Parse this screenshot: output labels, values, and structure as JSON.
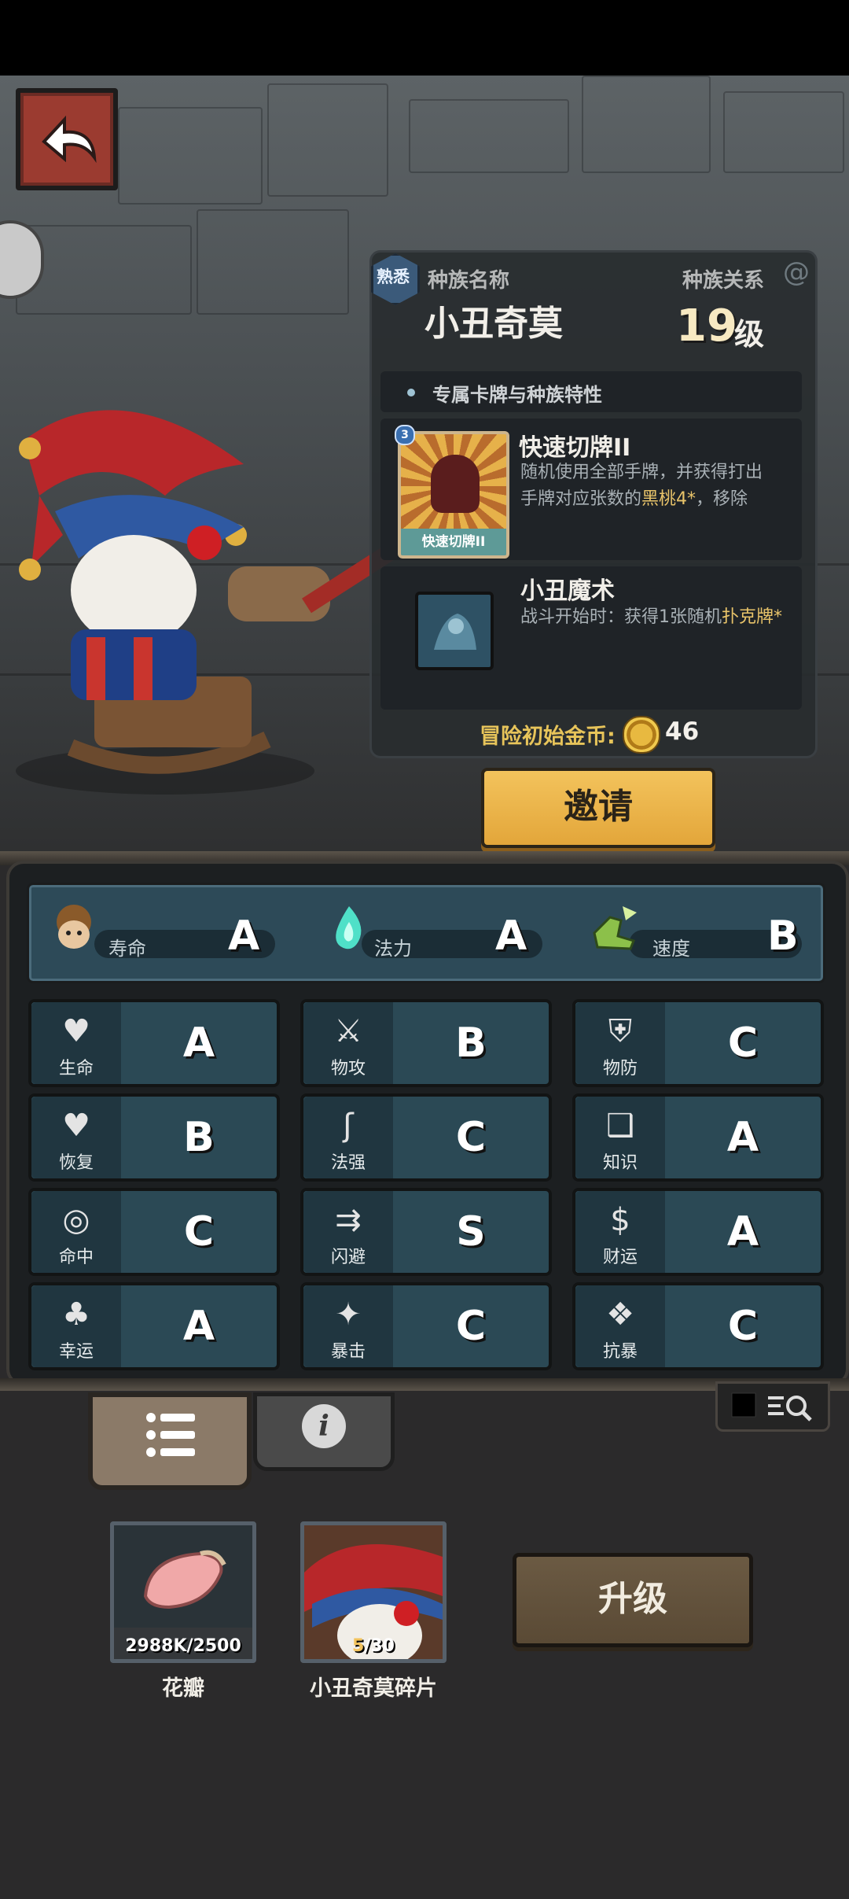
{
  "header": {
    "familiar_badge": "熟悉",
    "race_name_label": "种族名称",
    "race_relation_label": "种族关系",
    "race_name": "小丑奇莫",
    "level": "19",
    "level_unit": "级"
  },
  "section_title": "专属卡牌与种族特性",
  "cards": [
    {
      "title": "快速切牌II",
      "card_label": "快速切牌II",
      "cost": "3",
      "desc_line1": "随机使用全部手牌，并获得打出",
      "desc_line2_pre": "手牌对应张数的",
      "desc_line2_hl": "黑桃4*",
      "desc_line2_post": "，移除"
    },
    {
      "title": "小丑魔术",
      "desc_pre": "战斗开始时：获得1张随机",
      "desc_hl": "扑克牌*"
    }
  ],
  "coin": {
    "label": "冒险初始金币:",
    "value": "46"
  },
  "invite_label": "邀请",
  "attributes": [
    {
      "label": "寿命",
      "grade": "A",
      "icon": "lifespan-icon"
    },
    {
      "label": "法力",
      "grade": "A",
      "icon": "mana-flame-icon"
    },
    {
      "label": "速度",
      "grade": "B",
      "icon": "speed-boot-icon"
    }
  ],
  "stats": [
    {
      "label": "生命",
      "grade": "A",
      "icon": "heart-icon",
      "glyph": "♥"
    },
    {
      "label": "物攻",
      "grade": "B",
      "icon": "sword-icon",
      "glyph": "⚔"
    },
    {
      "label": "物防",
      "grade": "C",
      "icon": "armor-icon",
      "glyph": "⛨"
    },
    {
      "label": "恢复",
      "grade": "B",
      "icon": "heal-heart-icon",
      "glyph": "♥"
    },
    {
      "label": "法强",
      "grade": "C",
      "icon": "staff-icon",
      "glyph": "ʃ"
    },
    {
      "label": "知识",
      "grade": "A",
      "icon": "book-icon",
      "glyph": "❑"
    },
    {
      "label": "命中",
      "grade": "C",
      "icon": "target-icon",
      "glyph": "◎"
    },
    {
      "label": "闪避",
      "grade": "S",
      "icon": "dodge-arrows-icon",
      "glyph": "⇉"
    },
    {
      "label": "财运",
      "grade": "A",
      "icon": "coin-icon",
      "glyph": "$"
    },
    {
      "label": "幸运",
      "grade": "A",
      "icon": "clover-icon",
      "glyph": "♣"
    },
    {
      "label": "暴击",
      "grade": "C",
      "icon": "crit-icon",
      "glyph": "✦"
    },
    {
      "label": "抗暴",
      "grade": "C",
      "icon": "crit-resist-icon",
      "glyph": "❖"
    }
  ],
  "items": [
    {
      "name": "花瓣",
      "count": "2988K/2500",
      "icon": "petal-icon"
    },
    {
      "name": "小丑奇莫碎片",
      "count_current": "5",
      "count_total": "/30",
      "icon": "jester-portrait-icon"
    }
  ],
  "upgrade_label": "升级",
  "colors": {
    "accent_gold": "#e3a63a",
    "highlight": "#e9c46a",
    "stat_tile": "#2b4955",
    "count_highlight": "#f3c35c"
  }
}
